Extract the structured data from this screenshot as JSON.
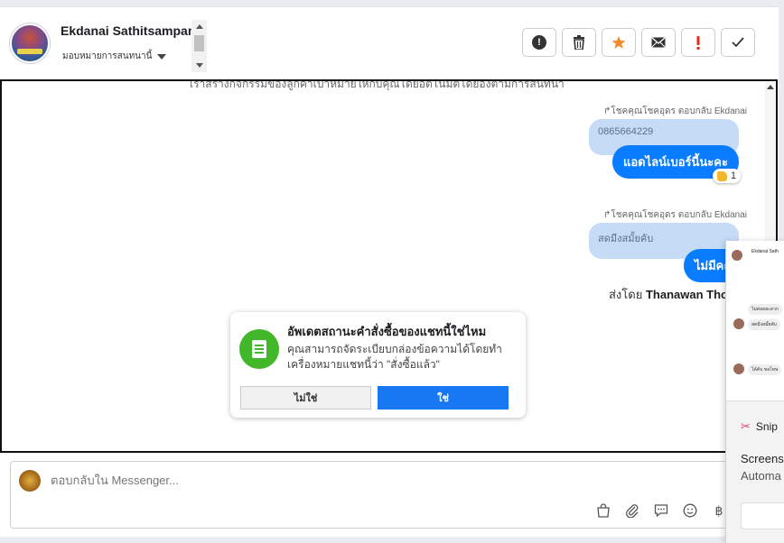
{
  "header": {
    "contact_name": "Ekdanai Sathitsampan",
    "assign_label": "มอบหมายการสนทนานี้"
  },
  "actions": [
    {
      "name": "spam-button",
      "icon": "exclamation-circle-icon"
    },
    {
      "name": "delete-button",
      "icon": "trash-icon"
    },
    {
      "name": "star-button",
      "icon": "star-icon",
      "color": "#f28b28"
    },
    {
      "name": "mark-unread-button",
      "icon": "envelope-icon"
    },
    {
      "name": "follow-up-button",
      "icon": "exclamation-icon",
      "color": "#e4281e"
    },
    {
      "name": "done-button",
      "icon": "checkmark-icon"
    }
  ],
  "chat": {
    "clipped_notice": "เราสร้างกิจกรรมของลูกค้าเป้าหมายให้กับคุณโดยอัตโนมัติโดยอิงตามการสนทนา",
    "messages": [
      {
        "reply_meta": "โชคคุณโชคอุดร ตอบกลับ Ekdanai",
        "quoted": "0865664229",
        "text": "แอดไลน์เบอร์นี้นะคะ",
        "reaction_count": "1"
      },
      {
        "reply_meta": "โชคคุณโชคอุดร ตอบกลับ Ekdanai",
        "quoted": "สดมีงสมั้ยคับ",
        "text": "ไม่มีคะ"
      }
    ],
    "sent_by_prefix": "ส่งโดย",
    "sent_by_name": "Thanawan Thon"
  },
  "dialog": {
    "title": "อัพเดตสถานะคำสั่งซื้อของแชทนี้ใช่ไหม",
    "body": "คุณสามารถจัดระเบียบกล่องข้อความได้โดยทำเครื่องหมายแชทนี้ว่า \"สั่งซื้อแล้ว\"",
    "no_label": "ไม่ใช่",
    "yes_label": "ใช่"
  },
  "composer": {
    "placeholder": "ตอบกลับใน Messenger...",
    "tools": [
      "shopping-bag-icon",
      "paperclip-icon",
      "saved-reply-icon",
      "emoji-icon",
      "baht-icon"
    ]
  },
  "snip": {
    "preview_name": "Ekdanai Sath",
    "preview_lines": [
      "ไม่ค่อยสะดวก",
      "สดมีงสมั้ยคับ",
      "ได้คับ ขอโทษ"
    ],
    "app_name": "Snip",
    "headline": "Screensh",
    "subline": "Automa"
  }
}
